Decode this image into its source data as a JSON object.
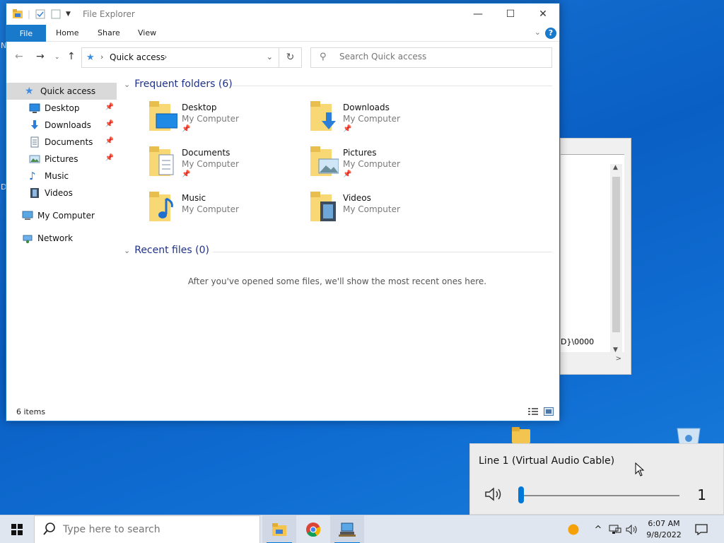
{
  "explorer": {
    "title": "File Explorer",
    "ribbon": {
      "file": "File",
      "tabs": [
        "Home",
        "Share",
        "View"
      ],
      "help": "?"
    },
    "address": {
      "crumb": "Quick access"
    },
    "search": {
      "placeholder": "Search Quick access"
    },
    "sidebar": [
      {
        "label": "Quick access",
        "icon": "star-icon",
        "selected": true,
        "pinned": false
      },
      {
        "label": "Desktop",
        "icon": "desktop-icon",
        "pinned": true
      },
      {
        "label": "Downloads",
        "icon": "downloads-icon",
        "pinned": true
      },
      {
        "label": "Documents",
        "icon": "documents-icon",
        "pinned": true
      },
      {
        "label": "Pictures",
        "icon": "pictures-icon",
        "pinned": true
      },
      {
        "label": "Music",
        "icon": "music-icon",
        "pinned": false
      },
      {
        "label": "Videos",
        "icon": "videos-icon",
        "pinned": false
      },
      {
        "label": "My Computer",
        "icon": "computer-icon",
        "pinned": false
      },
      {
        "label": "Network",
        "icon": "network-icon",
        "pinned": false
      }
    ],
    "frequent": {
      "header": "Frequent folders (6)",
      "items": [
        {
          "name": "Desktop",
          "location": "My Computer",
          "pinned": true
        },
        {
          "name": "Downloads",
          "location": "My Computer",
          "pinned": true
        },
        {
          "name": "Documents",
          "location": "My Computer",
          "pinned": true
        },
        {
          "name": "Pictures",
          "location": "My Computer",
          "pinned": true
        },
        {
          "name": "Music",
          "location": "My Computer",
          "pinned": false
        },
        {
          "name": "Videos",
          "location": "My Computer",
          "pinned": false
        }
      ]
    },
    "recent": {
      "header": "Recent files (0)",
      "empty_message": "After you've opened some files, we'll show the most recent ones here."
    },
    "status": {
      "count": "6 items"
    }
  },
  "background_window": {
    "visible_text": "D}\\0000"
  },
  "desktop_edge_letters": [
    "N",
    "D"
  ],
  "volume": {
    "device": "Line 1 (Virtual Audio Cable)",
    "level": 1,
    "level_max": 100
  },
  "taskbar": {
    "search_placeholder": "Type here to search",
    "clock_time": "6:07 AM",
    "clock_date": "9/8/2022"
  },
  "colors": {
    "accent": "#0078d7",
    "ribbon_file": "#1979ca",
    "folder": "#f8d775",
    "section_header": "#1e3287"
  }
}
